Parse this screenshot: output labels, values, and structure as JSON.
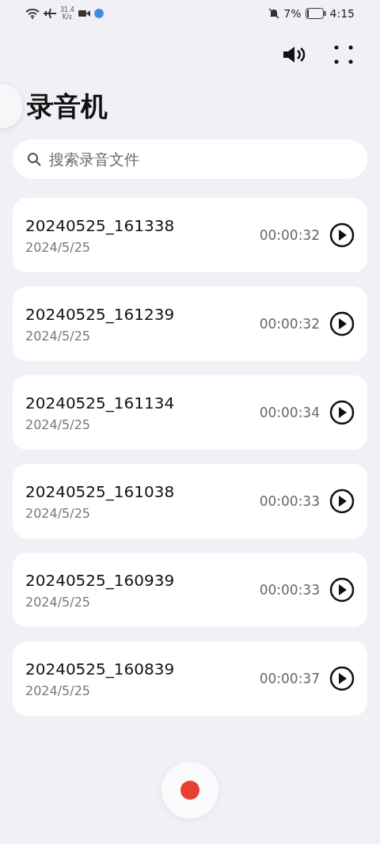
{
  "status_bar": {
    "speed_value": "31.4",
    "speed_unit": "K/s",
    "battery": "7%",
    "time": "4:15"
  },
  "title": "录音机",
  "search": {
    "placeholder": "搜索录音文件"
  },
  "recordings": [
    {
      "name": "20240525_161338",
      "date": "2024/5/25",
      "duration": "00:00:32"
    },
    {
      "name": "20240525_161239",
      "date": "2024/5/25",
      "duration": "00:00:32"
    },
    {
      "name": "20240525_161134",
      "date": "2024/5/25",
      "duration": "00:00:34"
    },
    {
      "name": "20240525_161038",
      "date": "2024/5/25",
      "duration": "00:00:33"
    },
    {
      "name": "20240525_160939",
      "date": "2024/5/25",
      "duration": "00:00:33"
    },
    {
      "name": "20240525_160839",
      "date": "2024/5/25",
      "duration": "00:00:37"
    }
  ]
}
